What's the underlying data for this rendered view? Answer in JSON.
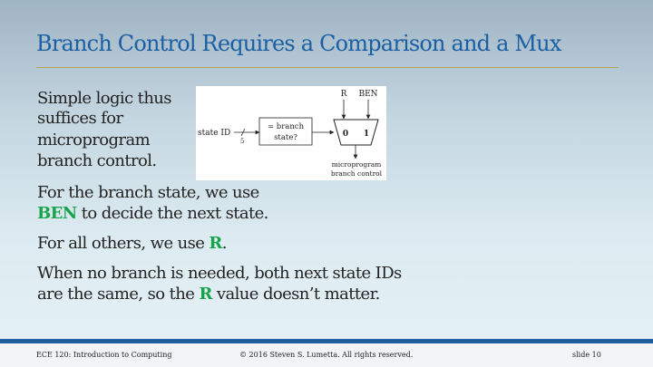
{
  "slide": {
    "title": "Branch Control Requires a Comparison and a Mux"
  },
  "body": {
    "intro": [
      "Simple logic thus",
      "suffices for",
      "microprogram",
      "branch control."
    ],
    "para1": {
      "line1": "For the branch state, we use",
      "line2_hl": "BEN",
      "line2_rest": " to decide the next state."
    },
    "para2": {
      "pre": "For all others, we use ",
      "hl": "R",
      "post": "."
    },
    "para3": {
      "line1": "When no branch is needed, both next state IDs",
      "line2_pre": "are the same, so the ",
      "line2_hl": "R",
      "line2_post": " value doesn’t matter."
    }
  },
  "figure": {
    "input_r": "R",
    "input_ben": "BEN",
    "state_id_label": "state ID",
    "bus_width": "5",
    "comparator_line1": "= branch",
    "comparator_line2": "state?",
    "mux_in0": "0",
    "mux_in1": "1",
    "output_line1": "microprogram",
    "output_line2": "branch control"
  },
  "footer": {
    "course": "ECE 120: Introduction to Computing",
    "copyright": "© 2016 Steven S. Lumetta.  All rights reserved.",
    "slide_number": "slide 10"
  },
  "colors": {
    "title": "#1a5fa3",
    "highlight": "#16a34a",
    "rule": "#b8a24a",
    "footer_band": "#1f5d9e"
  }
}
